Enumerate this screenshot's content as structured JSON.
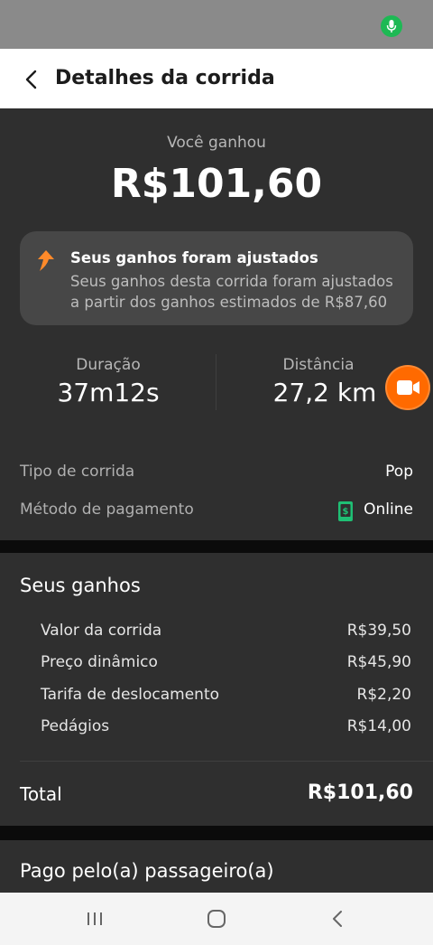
{
  "header": {
    "title": "Detalhes da corrida"
  },
  "earnings": {
    "label": "Você ganhou",
    "amount": "R$101,60"
  },
  "adjustment": {
    "title": "Seus ganhos foram ajustados",
    "text": "Seus ganhos desta corrida foram ajustados a partir dos ganhos estimados de R$87,60"
  },
  "stats": {
    "duration_label": "Duração",
    "duration_value": "37m12s",
    "distance_label": "Distância",
    "distance_value": "27,2 km"
  },
  "details": {
    "ride_type_label": "Tipo de corrida",
    "ride_type_value": "Pop",
    "payment_label": "Método de pagamento",
    "payment_value": "Online"
  },
  "earnings_section": {
    "title": "Seus ganhos",
    "items": [
      {
        "label": "Valor da corrida",
        "value": "R$39,50"
      },
      {
        "label": "Preço dinâmico",
        "value": "R$45,90"
      },
      {
        "label": "Tarifa de deslocamento",
        "value": "R$2,20"
      },
      {
        "label": "Pedágios",
        "value": "R$14,00"
      }
    ],
    "total_label": "Total",
    "total_value": "R$101,60"
  },
  "passenger_section": {
    "title": "Pago pelo(a) passageiro(a)"
  },
  "icons": {
    "back": "back-arrow-icon",
    "adjust": "arrow-up-right-icon",
    "video": "video-camera-icon",
    "payment": "phone-money-icon",
    "mic": "microphone-icon"
  },
  "colors": {
    "accent_orange": "#ff6a00",
    "payment_green": "#1fbf74",
    "mic_green": "#1db954"
  }
}
